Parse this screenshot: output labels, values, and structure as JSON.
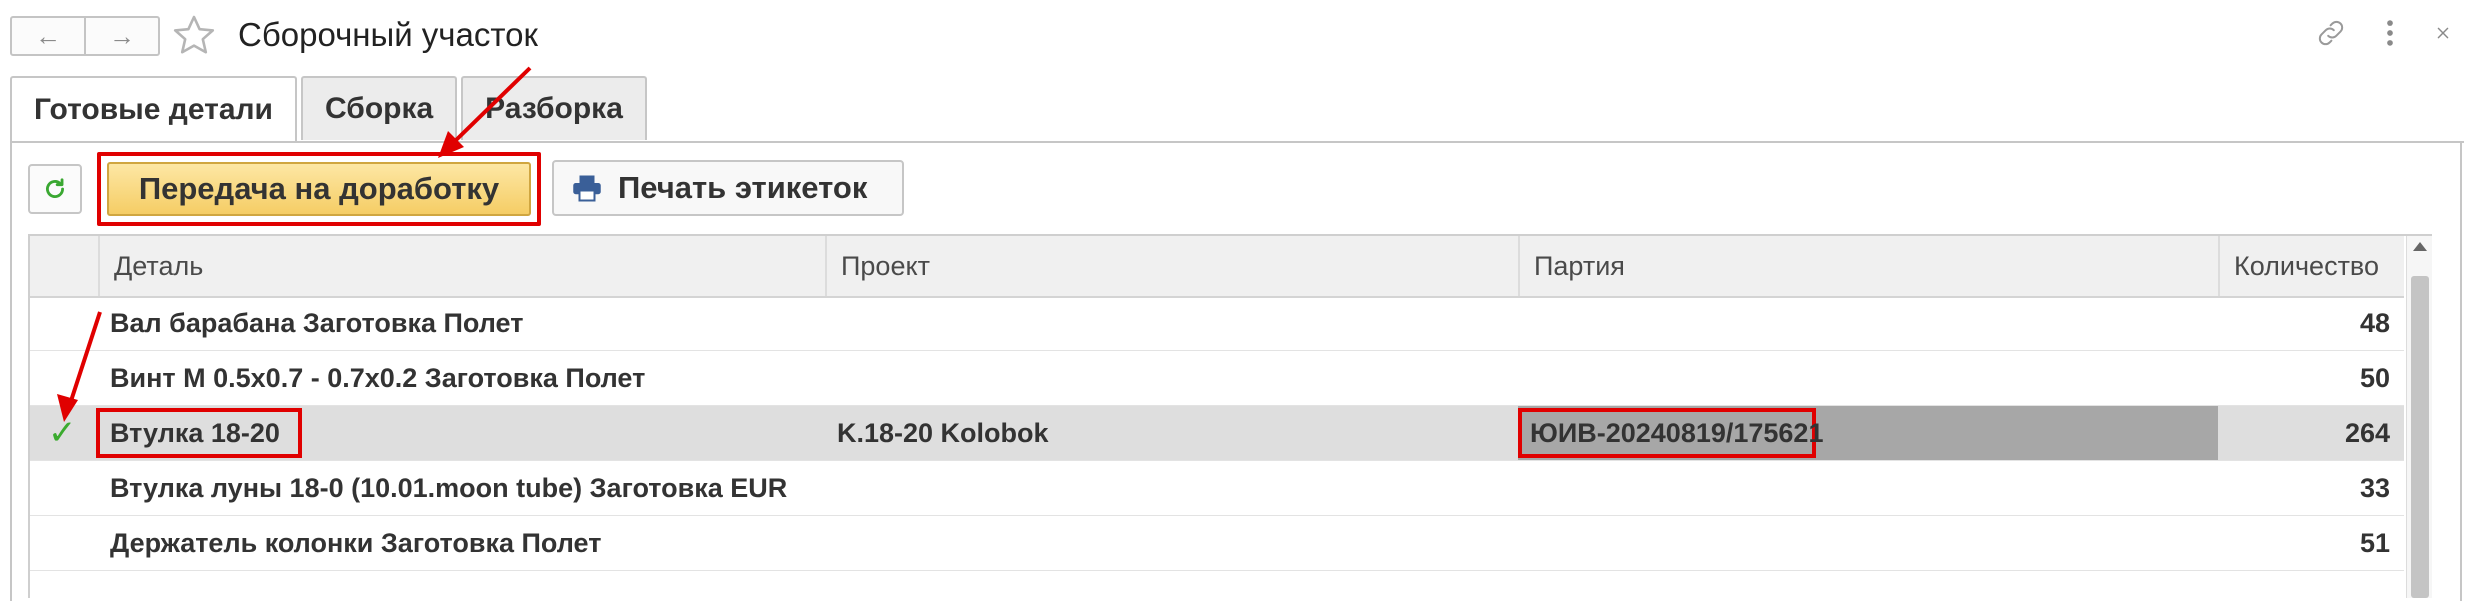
{
  "header": {
    "title": "Сборочный участок",
    "back_icon": "arrow-left-icon",
    "forward_icon": "arrow-right-icon",
    "favorite_icon": "star-icon",
    "link_icon": "link-icon",
    "menu_icon": "more-vertical-icon",
    "close_icon": "close-icon"
  },
  "tabs": [
    {
      "label": "Готовые детали",
      "active": true
    },
    {
      "label": "Сборка",
      "active": false
    },
    {
      "label": "Разборка",
      "active": false
    }
  ],
  "toolbar": {
    "refresh_icon": "refresh-icon",
    "transfer_label": "Передача на доработку",
    "print_icon": "printer-icon",
    "print_label": "Печать этикеток"
  },
  "table": {
    "columns": [
      "Деталь",
      "Проект",
      "Партия",
      "Количество"
    ],
    "rows": [
      {
        "detail": "Вал барабана Заготовка Полет",
        "project": "",
        "party": "",
        "qty": "48",
        "selected": false
      },
      {
        "detail": "Винт М 0.5x0.7 - 0.7x0.2 Заготовка Полет",
        "project": "",
        "party": "",
        "qty": "50",
        "selected": false
      },
      {
        "detail": "Втулка 18-20",
        "project": "K.18-20 Kolobok",
        "party": "ЮИВ-20240819/175621",
        "qty": "264",
        "selected": true
      },
      {
        "detail": "Втулка луны 18-0 (10.01.moon tube) Заготовка EUR",
        "project": "",
        "party": "",
        "qty": "33",
        "selected": false
      },
      {
        "detail": "Держатель колонки Заготовка Полет",
        "project": "",
        "party": "",
        "qty": "51",
        "selected": false
      }
    ]
  },
  "colors": {
    "accent_button": "#f5cd65",
    "highlight_red": "#e00000",
    "check_green": "#3bab2f",
    "selected_row": "#dedede"
  }
}
